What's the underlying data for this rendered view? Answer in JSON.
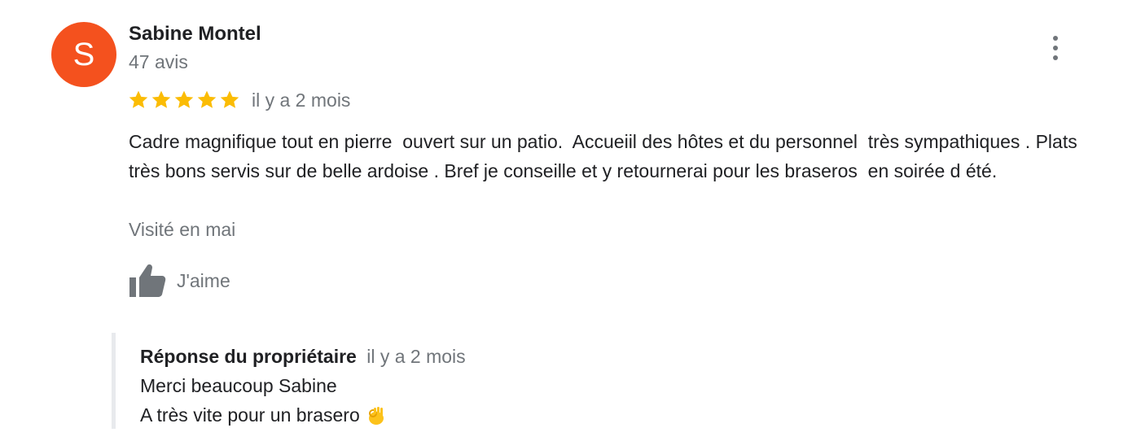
{
  "reviewer": {
    "avatar_letter": "S",
    "avatar_color": "#f4511e",
    "name": "Sabine Montel",
    "review_count": "47 avis"
  },
  "review": {
    "rating": 5,
    "rating_max": 5,
    "star_color": "#fbbc04",
    "time_ago": "il y a 2 mois",
    "text": "Cadre magnifique tout en pierre  ouvert sur un patio.  Accueiil des hôtes et du personnel  très sympathiques . Plats très bons servis sur de belle ardoise . Bref je conseille et y retournerai pour les braseros  en soirée d été.",
    "visited": "Visité en mai"
  },
  "actions": {
    "like_label": "J'aime",
    "like_icon": "thumbs-up-icon",
    "more_icon": "more-vert-icon"
  },
  "owner_reply": {
    "title": "Réponse du propriétaire",
    "time_ago": "il y a 2 mois",
    "line1": "Merci beaucoup Sabine",
    "line2": "A très vite pour un brasero",
    "emoji": "ok-hand-emoji"
  }
}
